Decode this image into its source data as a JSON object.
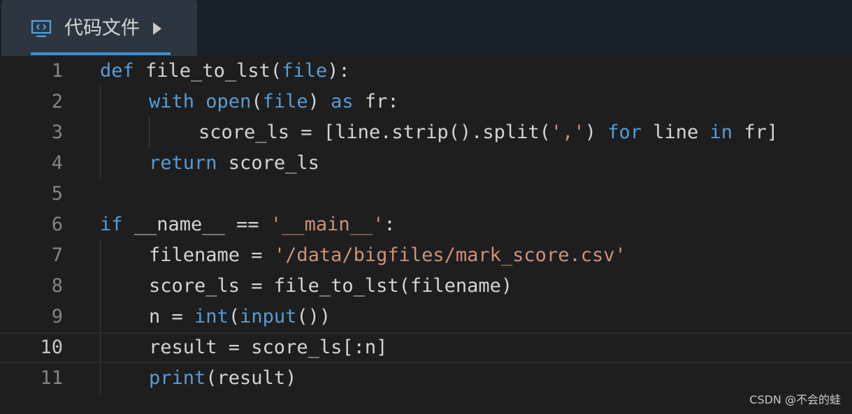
{
  "tab": {
    "icon": "code-file-icon",
    "label": "代码文件"
  },
  "editor": {
    "current_line": 10,
    "lines": [
      {
        "num": "1"
      },
      {
        "num": "2"
      },
      {
        "num": "3"
      },
      {
        "num": "4"
      },
      {
        "num": "5"
      },
      {
        "num": "6"
      },
      {
        "num": "7"
      },
      {
        "num": "8"
      },
      {
        "num": "9"
      },
      {
        "num": "10"
      },
      {
        "num": "11"
      }
    ],
    "tokens": {
      "l1": [
        "def",
        " file_to_lst(",
        "file",
        "):"
      ],
      "l2": [
        "with",
        " ",
        "open",
        "(",
        "file",
        ") ",
        "as",
        " fr:"
      ],
      "l3": [
        "score_ls = [line.strip().split(",
        "','",
        ") ",
        "for",
        " line ",
        "in",
        " fr]"
      ],
      "l4": [
        "return",
        " score_ls"
      ],
      "l6": [
        "if",
        " __name__ == ",
        "'__main__'",
        ":"
      ],
      "l7": [
        "filename = ",
        "'/data/bigfiles/mark_score.csv'"
      ],
      "l8": [
        "score_ls = file_to_lst(filename)"
      ],
      "l9": [
        "n = ",
        "int",
        "(",
        "input",
        "())"
      ],
      "l10": [
        "result = score_ls[:n]"
      ],
      "l11": [
        "print",
        "(result)"
      ]
    }
  },
  "watermark": "CSDN @不会的蛙",
  "colors": {
    "keyword": "#569cd6",
    "string": "#ce9178",
    "text": "#d4d4d4",
    "line_number": "#858585",
    "accent": "#3b8fd6"
  }
}
